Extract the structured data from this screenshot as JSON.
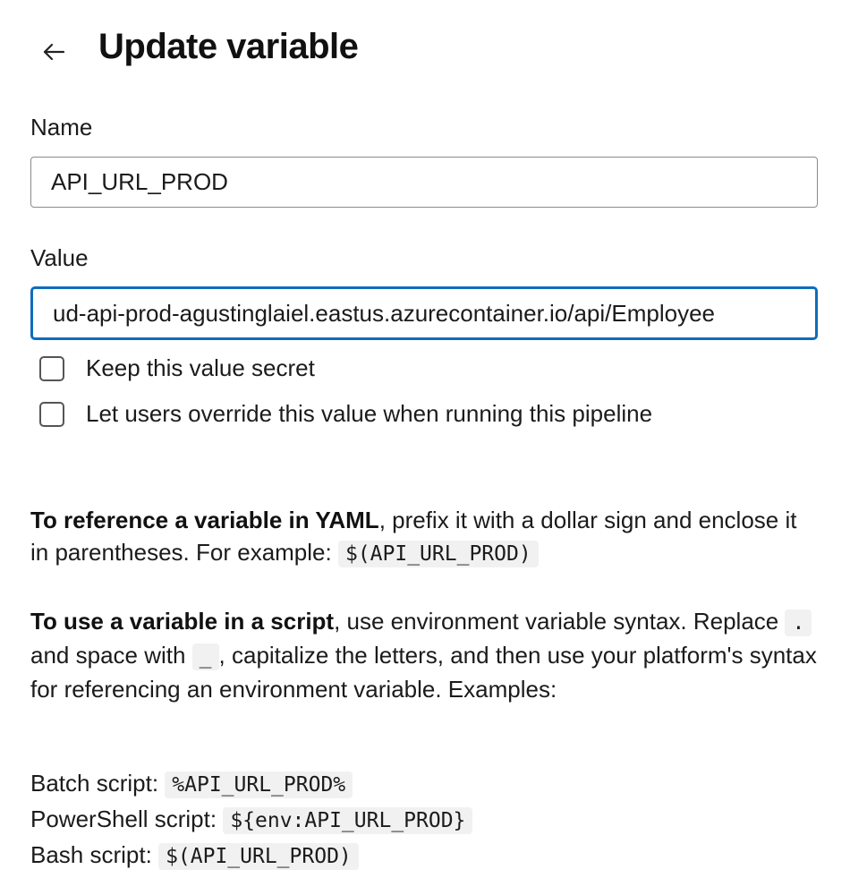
{
  "header": {
    "back_icon": "arrow-left-icon",
    "title": "Update variable"
  },
  "form": {
    "name_label": "Name",
    "name_value": "API_URL_PROD",
    "value_label": "Value",
    "value_value": "http://cloud-api-prod-agustinglaiel.eastus.azurecontainer.io/api/Employee",
    "value_visible": "ud-api-prod-agustinglaiel.eastus.azurecontainer.io/api/Employee",
    "secret_label": "Keep this value secret",
    "secret_checked": false,
    "override_label": "Let users override this value when running this pipeline",
    "override_checked": false
  },
  "help": {
    "yaml_bold": "To reference a variable in YAML",
    "yaml_text": ", prefix it with a dollar sign and enclose it in parentheses. For example: ",
    "yaml_code": "$(API_URL_PROD)",
    "script_bold": "To use a variable in a script",
    "script_text1": ", use environment variable syntax. Replace ",
    "script_code_dot": ".",
    "script_text2": " and space with ",
    "script_code_underscore": "_",
    "script_text3": ", capitalize the letters, and then use your platform's syntax for referencing an environment variable. Examples:",
    "examples": [
      {
        "label": "Batch script: ",
        "code": "%API_URL_PROD%"
      },
      {
        "label": "PowerShell script: ",
        "code": "${env:API_URL_PROD}"
      },
      {
        "label": "Bash script: ",
        "code": "$(API_URL_PROD)"
      }
    ]
  },
  "colors": {
    "focus_border": "#0f6cbd",
    "code_bg": "#f1f1f1"
  }
}
